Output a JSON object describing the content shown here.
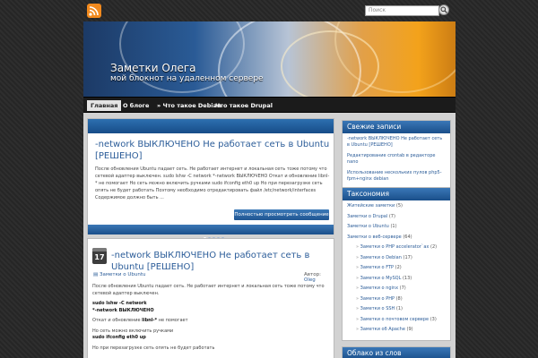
{
  "colors": {
    "accent": "#2c5d99",
    "bar": "#1a4f8a",
    "rss": "#f28a1e"
  },
  "search": {
    "placeholder": "Поиск"
  },
  "site": {
    "title": "Заметки Олега",
    "description": "мой блокнот на удаленном сервере"
  },
  "nav": {
    "items": [
      {
        "label": "Главная"
      },
      {
        "label": "О блоге"
      },
      {
        "label": "» Что такое Debian"
      },
      {
        "label": "Что такое Drupal"
      }
    ]
  },
  "featured": {
    "title": "-network ВЫКЛЮЧЕНО Не работает сеть в Ubuntu [РЕШЕНО]",
    "excerpt": "После обновления Ubuntu падает сеть. Не работает интернет и локальная сеть тоже потому что сетевой адаптер выключен. sudo lshw -C network   *-network ВЫКЛЮЧЕНО Откат и обновление libnl-* не помогает Но сеть можно включить ручками sudo ifconfig eth0 up Но при перезагрузке сеть опять не будет работать Поэтому необходимо отредактировать файл /etc/network/interfaces Содержимое должно быть ...",
    "button": "Полностью просмотреть сообщение"
  },
  "post": {
    "date_day": "17",
    "title": "-network ВЫКЛЮЧЕНО Не работает сеть в Ubuntu [РЕШЕНО]",
    "category": "Заметки о Ubuntu",
    "author_label": "Автор:",
    "author": "Oleg",
    "intro": "После обновления Ubuntu падает сеть. Не работает интернет и локальная сеть тоже потому что сетевой адаптер выключен.",
    "cmd1": "sudo lshw -C network",
    "cmd2": "*-network ВЫКЛЮЧЕНО",
    "rollback_prefix": "Откат и обновление ",
    "rollback_pkg": "libnl-*",
    "rollback_suffix": " не помогает",
    "manual": "Но сеть можно включить ручками",
    "cmd3": "sudo ifconfig eth0 up",
    "reboot": "Но при перезагрузке сеть опять не будет работать"
  },
  "sidebar": {
    "recent": {
      "title": "Свежие записи",
      "items": [
        "-network ВЫКЛЮЧЕНО Не работает сеть в Ubuntu [РЕШЕНО]",
        "Редактирование crontab в редакторе nano",
        "Использование нескольких пулов php5-fpm+nginx debian"
      ]
    },
    "taxonomy": {
      "title": "Таксономия",
      "items": [
        {
          "label": "Житейские заметки",
          "count": "(5)"
        },
        {
          "label": "Заметки о Drupal",
          "count": "(7)"
        },
        {
          "label": "Заметки о Ubuntu",
          "count": "(1)"
        },
        {
          "label": "Заметки о веб-сервере",
          "count": "(64)"
        },
        {
          "label": "Заметки о PHP accelerator`ax",
          "count": "(2)"
        },
        {
          "label": "Заметки о Debian",
          "count": "(17)"
        },
        {
          "label": "Заметки о FTP",
          "count": "(2)"
        },
        {
          "label": "Заметки о MySQL",
          "count": "(13)"
        },
        {
          "label": "Заметки о nginx",
          "count": "(7)"
        },
        {
          "label": "Заметки о PHP",
          "count": "(8)"
        },
        {
          "label": "Заметки о SSH",
          "count": "(1)"
        },
        {
          "label": "Заметки о почтовом сервере",
          "count": "(3)"
        },
        {
          "label": "Заметки об Apache",
          "count": "(9)"
        }
      ]
    },
    "cloud": {
      "title": "Облако из слов"
    }
  }
}
